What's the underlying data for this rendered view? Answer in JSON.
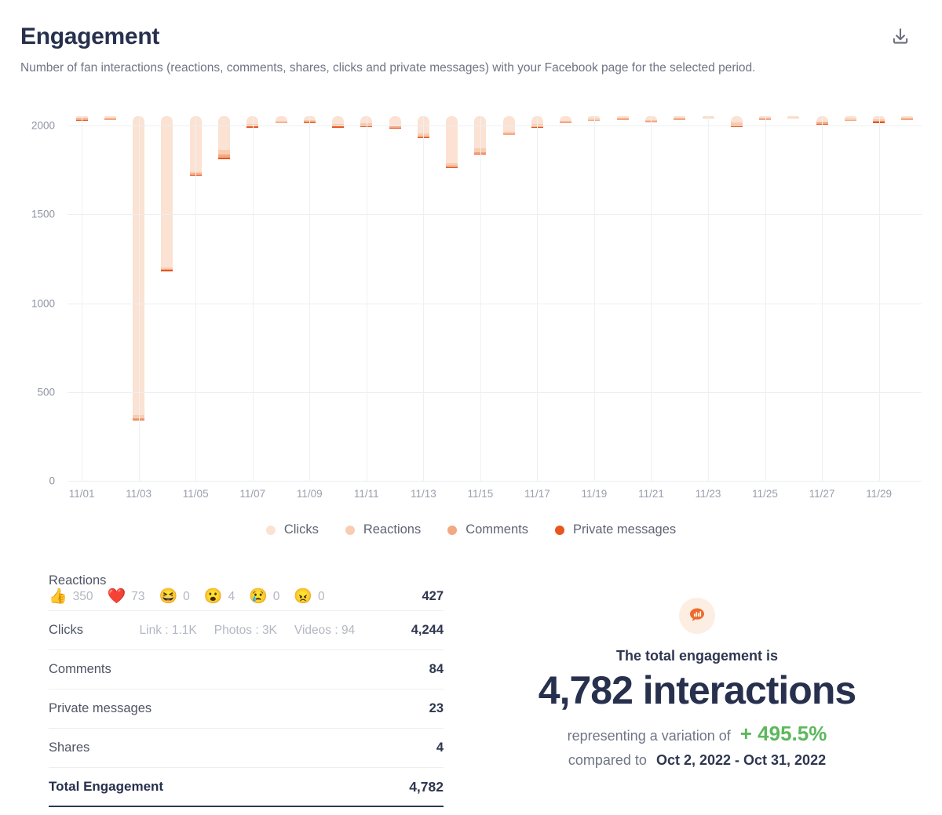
{
  "header": {
    "title": "Engagement",
    "subtitle": "Number of fan interactions (reactions, comments, shares, clicks and private messages) with your Facebook page for the selected period.",
    "download_icon": "download-icon"
  },
  "colors": {
    "clicks": "#fbe2d3",
    "reactions": "#f8cdb2",
    "comments": "#f2a882",
    "private_messages": "#e8561f",
    "positive": "#5cb85c",
    "text_dark": "#2e3650",
    "text_muted": "#8e93a1"
  },
  "legend": [
    {
      "label": "Clicks",
      "color": "#fbe2d3"
    },
    {
      "label": "Reactions",
      "color": "#f8cdb2"
    },
    {
      "label": "Comments",
      "color": "#f2a882"
    },
    {
      "label": "Private messages",
      "color": "#e8561f"
    }
  ],
  "chart_data": {
    "type": "bar",
    "stacked": true,
    "title": "Engagement",
    "xlabel": "",
    "ylabel": "",
    "ylim": [
      0,
      2000
    ],
    "yticks": [
      0,
      500,
      1000,
      1500,
      2000
    ],
    "ytick_labels": [
      "0",
      "500",
      "1000",
      "1500",
      "2000"
    ],
    "grid": true,
    "legend_position": "bottom",
    "x": [
      "11/01",
      "11/02",
      "11/03",
      "11/04",
      "11/05",
      "11/06",
      "11/07",
      "11/08",
      "11/09",
      "11/10",
      "11/11",
      "11/12",
      "11/13",
      "11/14",
      "11/15",
      "11/16",
      "11/17",
      "11/18",
      "11/19",
      "11/20",
      "11/21",
      "11/22",
      "11/23",
      "11/24",
      "11/25",
      "11/26",
      "11/27",
      "11/28",
      "11/29",
      "11/30"
    ],
    "xtick_labels": [
      "11/01",
      "11/03",
      "11/05",
      "11/07",
      "11/09",
      "11/11",
      "11/13",
      "11/15",
      "11/17",
      "11/19",
      "11/21",
      "11/23",
      "11/25",
      "11/27",
      "11/29"
    ],
    "series": [
      {
        "name": "Private messages",
        "color": "#e8561f",
        "values": [
          1,
          0,
          4,
          2,
          2,
          3,
          1,
          0,
          1,
          1,
          1,
          1,
          2,
          1,
          1,
          0,
          1,
          0,
          0,
          0,
          0,
          0,
          0,
          1,
          0,
          0,
          1,
          0,
          1,
          0
        ]
      },
      {
        "name": "Comments",
        "color": "#f2a882",
        "values": [
          2,
          2,
          10,
          6,
          6,
          18,
          3,
          2,
          2,
          3,
          2,
          3,
          6,
          8,
          10,
          4,
          6,
          3,
          2,
          1,
          2,
          1,
          0,
          4,
          1,
          0,
          3,
          2,
          4,
          1
        ]
      },
      {
        "name": "Reactions",
        "color": "#f8cdb2",
        "values": [
          4,
          3,
          18,
          10,
          8,
          28,
          6,
          4,
          4,
          6,
          4,
          5,
          16,
          14,
          22,
          8,
          10,
          6,
          5,
          2,
          4,
          2,
          1,
          12,
          2,
          1,
          7,
          4,
          8,
          2
        ]
      },
      {
        "name": "Clicks",
        "color": "#fbe2d3",
        "values": [
          7,
          8,
          1680,
          850,
          315,
          190,
          45,
          28,
          22,
          45,
          40,
          52,
          95,
          265,
          180,
          90,
          45,
          25,
          15,
          8,
          20,
          5,
          2,
          35,
          5,
          3,
          30,
          14,
          18,
          6
        ]
      }
    ],
    "totals": [
      14,
      13,
      1712,
      868,
      331,
      239,
      55,
      34,
      29,
      55,
      47,
      61,
      119,
      288,
      213,
      102,
      62,
      34,
      22,
      11,
      26,
      8,
      3,
      52,
      8,
      4,
      41,
      20,
      31,
      9
    ]
  },
  "table": {
    "reactions": {
      "label": "Reactions",
      "total": "427",
      "items": [
        {
          "name": "like-reaction",
          "emoji": "👍",
          "count": "350"
        },
        {
          "name": "love-reaction",
          "emoji": "❤️",
          "count": "73"
        },
        {
          "name": "haha-reaction",
          "emoji": "😆",
          "count": "0"
        },
        {
          "name": "wow-reaction",
          "emoji": "😮",
          "count": "4"
        },
        {
          "name": "sad-reaction",
          "emoji": "😢",
          "count": "0"
        },
        {
          "name": "angry-reaction",
          "emoji": "😠",
          "count": "0"
        }
      ]
    },
    "clicks": {
      "label": "Clicks",
      "total": "4,244",
      "breakdown": [
        "Link : 1.1K",
        "Photos : 3K",
        "Videos : 94"
      ]
    },
    "rows": [
      {
        "label": "Comments",
        "value": "84"
      },
      {
        "label": "Private messages",
        "value": "23"
      },
      {
        "label": "Shares",
        "value": "4"
      }
    ],
    "total": {
      "label": "Total Engagement",
      "value": "4,782"
    }
  },
  "summary": {
    "icon": "engagement-bubble-icon",
    "lead": "The total engagement is",
    "big": "4,782 interactions",
    "variation_prefix": "representing a variation of",
    "variation": "+ 495.5%",
    "compared_prefix": "compared to",
    "compared_period": "Oct 2, 2022 - Oct 31, 2022"
  }
}
